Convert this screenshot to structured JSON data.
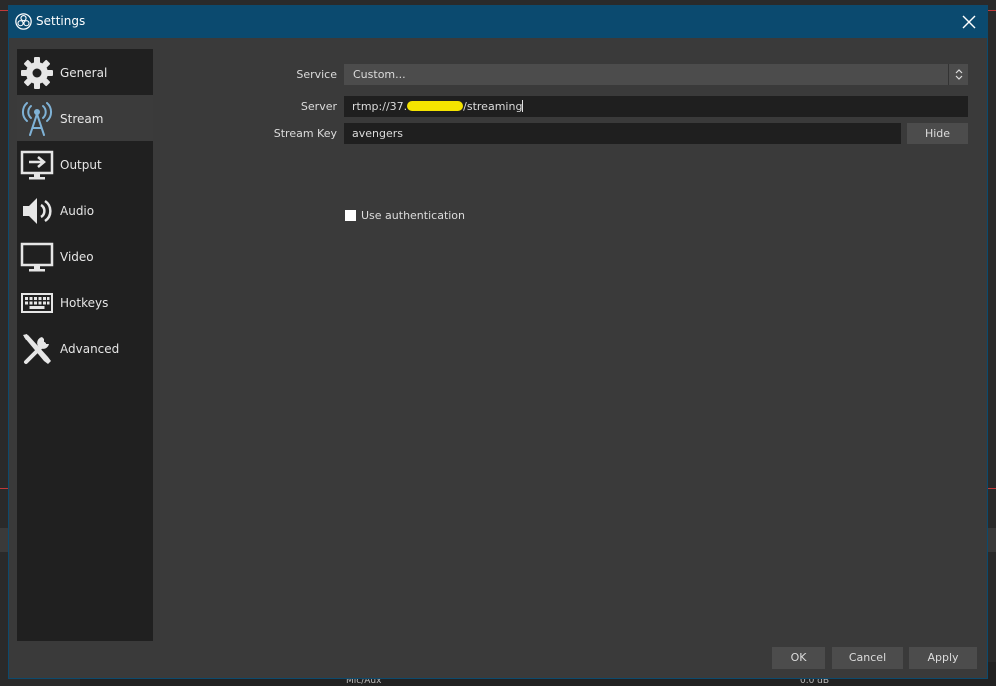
{
  "window": {
    "title": "Settings",
    "close_icon": "close-icon"
  },
  "sidebar": {
    "items": [
      {
        "label": "General",
        "icon": "gear-icon",
        "selected": false
      },
      {
        "label": "Stream",
        "icon": "broadcast-antenna-icon",
        "selected": true
      },
      {
        "label": "Output",
        "icon": "monitor-output-icon",
        "selected": false
      },
      {
        "label": "Audio",
        "icon": "speaker-icon",
        "selected": false
      },
      {
        "label": "Video",
        "icon": "monitor-icon",
        "selected": false
      },
      {
        "label": "Hotkeys",
        "icon": "keyboard-icon",
        "selected": false
      },
      {
        "label": "Advanced",
        "icon": "tools-icon",
        "selected": false
      }
    ]
  },
  "stream": {
    "service_label": "Service",
    "service_value": "Custom...",
    "server_label": "Server",
    "server_value_prefix": "rtmp://37.",
    "server_value_suffix": "/streaming",
    "stream_key_label": "Stream Key",
    "stream_key_value": "avengers",
    "hide_button": "Hide",
    "use_auth_label": "Use authentication",
    "use_auth_checked": false
  },
  "footer": {
    "ok": "OK",
    "cancel": "Cancel",
    "apply": "Apply"
  },
  "background": {
    "bottom_text_left": "Mic/Aux",
    "bottom_text_right": "0.0 dB"
  },
  "colors": {
    "titlebar": "#0b4a6f",
    "redaction": "#f5e400"
  }
}
